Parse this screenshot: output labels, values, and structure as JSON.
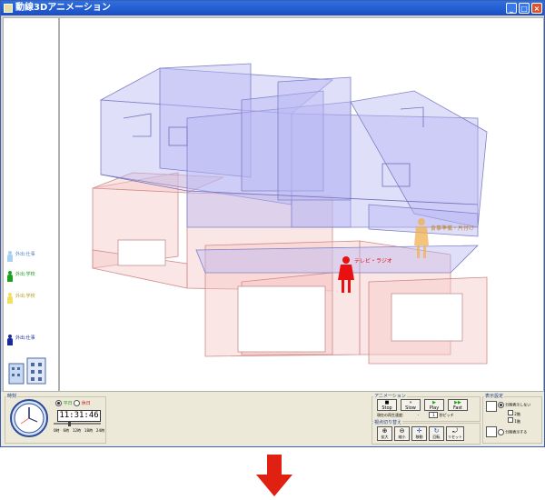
{
  "window": {
    "title": "動線3Dアニメーション"
  },
  "legend": {
    "items": [
      {
        "label": "外出:仕事",
        "color": "#a8d0f0"
      },
      {
        "label": "外出:学校",
        "color": "#20a020"
      },
      {
        "label": "外出:学校",
        "color": "#f0e060"
      },
      {
        "label": "外出:仕事",
        "color": "#1a2a9a"
      }
    ]
  },
  "scene": {
    "labels": {
      "person_red": "テレビ・ラジオ",
      "person_orange": "食事準備・片付け"
    }
  },
  "time_panel": {
    "title": "時刻",
    "day_options": [
      "平日",
      "休日"
    ],
    "selected_day": "平日",
    "time_display": "11:31:46",
    "slider_ticks": [
      "0時",
      "6時",
      "12時",
      "18時",
      "24時"
    ]
  },
  "animation_panel": {
    "title": "アニメーション",
    "buttons": [
      "Stop",
      "Slow",
      "Play",
      "Fast"
    ],
    "speed_label": "現在の再生速度:",
    "speed_value": "-",
    "pitch_value": "1",
    "pitch_label": "秒ピッチ"
  },
  "view_panel": {
    "title": "視点切り替え",
    "buttons": [
      "拡大",
      "縮小",
      "移動",
      "回転",
      "リセット"
    ]
  },
  "display_panel": {
    "title": "表示設定",
    "no_split_label": "分割表示しない",
    "floor2_label": "2階",
    "floor1_label": "1階",
    "split_label": "分割表示する"
  }
}
